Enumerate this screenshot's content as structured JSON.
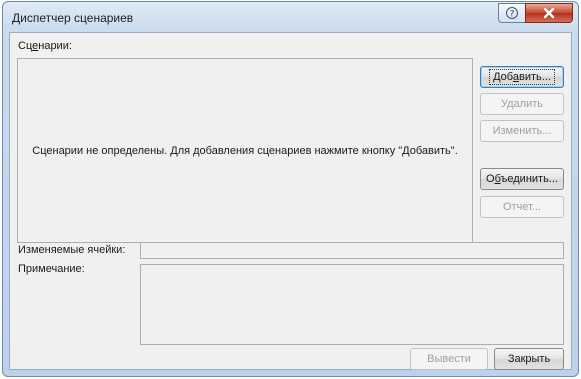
{
  "window": {
    "title": "Диспетчер сценариев",
    "help_glyph": "?",
    "close_glyph": "✕"
  },
  "scenarios": {
    "label_prefix": "Сц",
    "label_mnemonic": "е",
    "label_suffix": "нарии:",
    "empty_message": "Сценарии не определены. Для добавления сценариев нажмите кнопку \"Добавить\"."
  },
  "buttons": {
    "add": {
      "prefix": "Доб",
      "mnemonic": "а",
      "suffix": "вить...",
      "enabled": true
    },
    "delete": {
      "label": "Удалить",
      "enabled": false
    },
    "edit": {
      "label": "Изменить...",
      "enabled": false
    },
    "merge": {
      "prefix": "О",
      "mnemonic": "б",
      "suffix": "ъединить...",
      "enabled": true
    },
    "report": {
      "label": "Отчет...",
      "enabled": false
    },
    "show": {
      "label": "Вывести",
      "enabled": false
    },
    "close": {
      "label": "Закрыть",
      "enabled": true
    }
  },
  "changing_cells": {
    "label": "Изменяемые ячейки:",
    "value": ""
  },
  "comment": {
    "label": "Примечание:",
    "value": ""
  },
  "colors": {
    "title_bar": "#c9dbee",
    "close_button": "#c7462e",
    "dialog_face": "#f0f0f0",
    "disabled_text": "#a0a0a0"
  }
}
